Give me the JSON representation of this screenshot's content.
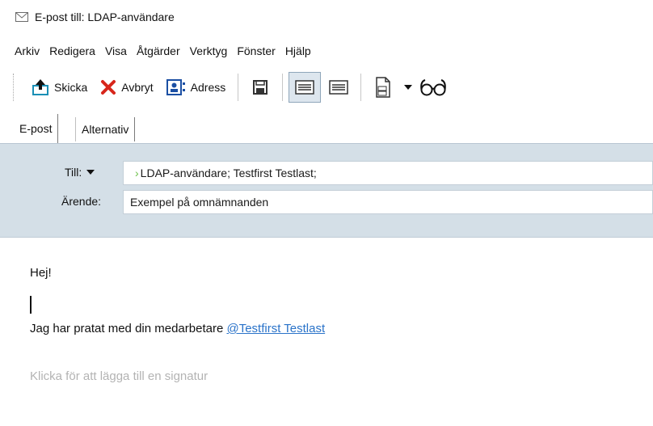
{
  "window": {
    "title": "E-post till: LDAP-användare",
    "icon": "mail-envelope-icon"
  },
  "menu": {
    "items": [
      "Arkiv",
      "Redigera",
      "Visa",
      "Åtgärder",
      "Verktyg",
      "Fönster",
      "Hjälp"
    ]
  },
  "toolbar": {
    "send_label": "Skicka",
    "cancel_label": "Avbryt",
    "address_label": "Adress",
    "icons": [
      "send-icon",
      "cancel-icon",
      "address-book-icon",
      "save-icon",
      "format-html-icon",
      "format-plaintext-icon",
      "template-icon",
      "dropdown-arrow-icon",
      "spectacles-icon"
    ]
  },
  "tabs": {
    "email": "E-post",
    "options": "Alternativ"
  },
  "header": {
    "to_label": "Till:",
    "to_value": "LDAP-användare;  Testfirst Testlast;",
    "subject_label": "Ärende:",
    "subject_value": "Exempel på omnämnanden"
  },
  "body": {
    "greeting": "Hej!",
    "line_prefix": "Jag har pratat med din medarbetare ",
    "mention": "@Testfirst  Testlast",
    "signature_placeholder": "Klicka för att lägga till en signatur"
  },
  "colors": {
    "header_panel": "#d4dfe7",
    "mention_link": "#2a73c9",
    "to_arrow": "#6cc24a",
    "cancel_red": "#d7261b",
    "send_teal": "#1a8fb5"
  }
}
